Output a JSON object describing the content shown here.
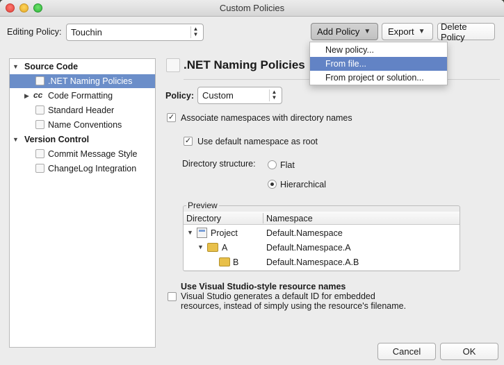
{
  "window": {
    "title": "Custom Policies"
  },
  "toolbar": {
    "editing_label": "Editing Policy:",
    "editing_value": "Touchin",
    "add_policy": "Add Policy",
    "export": "Export",
    "delete_policy": "Delete Policy"
  },
  "add_menu": {
    "items": [
      "New policy...",
      "From file...",
      "From project or solution..."
    ],
    "highlighted": "From file..."
  },
  "sidebar": {
    "source_code": "Source Code",
    "items_source": [
      ".NET Naming Policies",
      "Code Formatting",
      "Standard Header",
      "Name Conventions"
    ],
    "version_control": "Version Control",
    "items_vc": [
      "Commit Message Style",
      "ChangeLog Integration"
    ]
  },
  "main": {
    "title": ".NET Naming Policies",
    "policy_label": "Policy:",
    "policy_value": "Custom",
    "assoc_label": "Associate namespaces with directory names",
    "default_ns_label": "Use default namespace as root",
    "dir_structure_label": "Directory structure:",
    "flat_label": "Flat",
    "hier_label": "Hierarchical",
    "preview_label": "Preview",
    "preview_cols": [
      "Directory",
      "Namespace"
    ],
    "preview_rows": [
      {
        "dir": "Project",
        "ns": "Default.Namespace"
      },
      {
        "dir": "A",
        "ns": "Default.Namespace.A"
      },
      {
        "dir": "B",
        "ns": "Default.Namespace.A.B"
      }
    ],
    "vs_title": "Use Visual Studio-style resource names",
    "vs_desc_1": "Visual Studio generates a default ID for embedded",
    "vs_desc_2": "resources, instead of simply using the resource's filename."
  },
  "buttons": {
    "cancel": "Cancel",
    "ok": "OK"
  }
}
